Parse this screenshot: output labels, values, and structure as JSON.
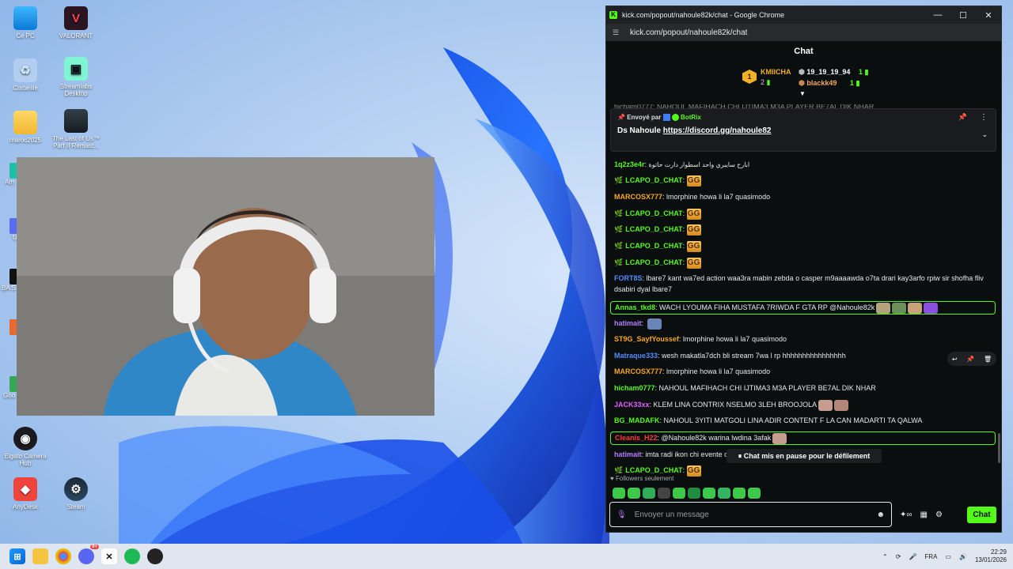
{
  "desktop": {
    "icons": [
      {
        "label": "Ce PC",
        "icon": "monitor-icon"
      },
      {
        "label": "VALORANT",
        "icon": "valorant-icon"
      },
      {
        "label": "Corbeille",
        "icon": "recycle-bin-icon"
      },
      {
        "label": "Streamlabs Desktop",
        "icon": "streamlabs-icon"
      },
      {
        "label": "maroc2025",
        "icon": "folder-icon"
      },
      {
        "label": "The Last of Us™ Part II Remast...",
        "icon": "tlou-icon"
      },
      {
        "label": "Elgato Camera Hub",
        "icon": "elgato-icon"
      },
      {
        "label": "AnyDesk",
        "icon": "anydesk-icon"
      },
      {
        "label": "Steam",
        "icon": "steam-icon"
      }
    ],
    "side_fragments": [
      "Am",
      "U",
      "BA S",
      "Goo"
    ]
  },
  "chrome": {
    "title": "kick.com/popout/nahoule82k/chat - Google Chrome",
    "url": "kick.com/popout/nahoule82k/chat"
  },
  "chat": {
    "header": "Chat",
    "leaderboard": {
      "first": {
        "rank": "1",
        "name": "KMIICHA",
        "count": "2"
      },
      "others": [
        {
          "name": "19_19_19_94",
          "count": "1"
        },
        {
          "name": "blackk49",
          "count": "1"
        }
      ]
    },
    "truncated_line": "hicham0777: NAHOUL MAFIHACH CHI IJTIMA3 M3A PLAYER BE7AL DIK NHAR",
    "pinned": {
      "sent_by_label": "Envoyé par",
      "sender": "BotRix",
      "text_prefix": "Ds Nahoule",
      "link": "https://discord.gg/nahoule82"
    },
    "messages": [
      {
        "user": "1q2z3e4r",
        "color": "#53fc18",
        "text": "ابارح سايبري واحد اسطوار دارت حاتوة",
        "highlight": false,
        "badge": false,
        "gg": false
      },
      {
        "user": "LCAPO_D_CHAT",
        "color": "#53fc18",
        "text": "",
        "highlight": false,
        "badge": true,
        "gg": true
      },
      {
        "user": "MARCOSX777",
        "color": "#f5a623",
        "text": "lmorphine howa li la7 quasimodo",
        "highlight": false,
        "badge": false,
        "gg": false
      },
      {
        "user": "LCAPO_D_CHAT",
        "color": "#53fc18",
        "text": "",
        "highlight": false,
        "badge": true,
        "gg": true
      },
      {
        "user": "LCAPO_D_CHAT",
        "color": "#53fc18",
        "text": "",
        "highlight": false,
        "badge": true,
        "gg": true
      },
      {
        "user": "LCAPO_D_CHAT",
        "color": "#53fc18",
        "text": "",
        "highlight": false,
        "badge": true,
        "gg": true
      },
      {
        "user": "LCAPO_D_CHAT",
        "color": "#53fc18",
        "text": "",
        "highlight": false,
        "badge": true,
        "gg": true
      },
      {
        "user": "FORT8S",
        "color": "#4f8dff",
        "text": "lbare7 kant wa7ed action waa3ra mabin zebda o casper m9aaaawda o7ta drari kay3arfo rpiw sir shofha fliv dsabiri dyal lbare7",
        "highlight": false,
        "badge": false,
        "gg": false
      },
      {
        "user": "Annas_tkd8",
        "color": "#53fc18",
        "text": "WACH LYOUMA FIHA MUSTAFA 7RIWDA F GTA RP @Nahoule82k",
        "highlight": true,
        "badge": false,
        "gg": false
      },
      {
        "user": "hatimait",
        "color": "#b37bff",
        "text": "",
        "highlight": false,
        "badge": false,
        "gg": false
      },
      {
        "user": "ST9G_SayfYoussef",
        "color": "#f5a623",
        "text": "lmorphine howa li la7 quasimodo",
        "highlight": false,
        "badge": false,
        "gg": false
      },
      {
        "user": "Matraque333",
        "color": "#4f8dff",
        "text": "wesh makatla7dch bli stream 7wa l rp hhhhhhhhhhhhhhhh",
        "highlight": false,
        "badge": false,
        "gg": false
      },
      {
        "user": "MARCOSX777",
        "color": "#f5a623",
        "text": "lmorphine howa li la7 quasimodo",
        "highlight": false,
        "badge": false,
        "gg": false
      },
      {
        "user": "hicham0777",
        "color": "#53fc18",
        "text": "NAHOUL MAFIHACH CHI IJTIMA3 M3A PLAYER BE7AL DIK NHAR",
        "highlight": false,
        "badge": false,
        "gg": false
      },
      {
        "user": "JACK33xx",
        "color": "#e35cff",
        "text": "KLEM LINA CONTRIX NSELMO 3LEH BROOJOLA",
        "highlight": false,
        "badge": false,
        "gg": false
      },
      {
        "user": "BG_MADAFK",
        "color": "#53fc18",
        "text": "NAHOUL 3YITI MATGOLI LINA ADIR CONTENT F LA CAN MADARTI TA QALWA",
        "highlight": false,
        "badge": false,
        "gg": false
      },
      {
        "user": "Cleanis_H22",
        "color": "#ff3b3b",
        "text": "@Nahoule82k warina lwdina 3afak",
        "highlight": true,
        "badge": false,
        "gg": false
      },
      {
        "user": "hatimait",
        "color": "#b37bff",
        "text": "imta radi ikon chi evente dyal rp f rp",
        "highlight": false,
        "badge": false,
        "gg": false
      },
      {
        "user": "LCAPO_D_CHAT",
        "color": "#53fc18",
        "text": "",
        "highlight": false,
        "badge": true,
        "gg": true
      }
    ],
    "gg_text": "GG",
    "pause_notice": "Chat mis en pause pour le défilement",
    "followers_only": "Followers seulement",
    "input_placeholder": "Envoyer un message",
    "send_label": "Chat"
  },
  "taskbar": {
    "language": "FRA",
    "time": "22:29",
    "date": "13/01/2026",
    "discord_badge": "9+"
  }
}
